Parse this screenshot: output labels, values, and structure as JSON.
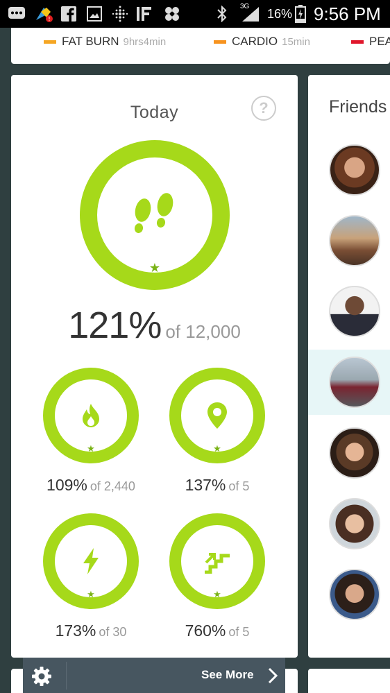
{
  "status_bar": {
    "battery_percent": "16%",
    "network": "3G",
    "time": "9:56 PM",
    "left_icons": [
      "messages-icon",
      "cleaner-app-icon",
      "facebook-icon",
      "gallery-icon",
      "fitbit-icon",
      "ifttt-icon",
      "pinwheel-icon"
    ]
  },
  "zones": [
    {
      "label": "FAT BURN",
      "duration": "9hrs4min",
      "color": "#f5a623"
    },
    {
      "label": "CARDIO",
      "duration": "15min",
      "color": "#f7931e"
    },
    {
      "label": "PEA",
      "duration": "",
      "color": "#e0162b"
    }
  ],
  "today": {
    "title": "Today",
    "help_label": "?",
    "steps": {
      "percent": "121%",
      "goal": "of 12,000",
      "icon": "footprints-icon"
    },
    "stats": [
      {
        "percent": "109%",
        "goal": "of 2,440",
        "icon": "flame-icon"
      },
      {
        "percent": "137%",
        "goal": "of 5",
        "icon": "location-pin-icon"
      },
      {
        "percent": "173%",
        "goal": "of 30",
        "icon": "lightning-icon"
      },
      {
        "percent": "760%",
        "goal": "of 5",
        "icon": "stairs-icon"
      }
    ]
  },
  "friends": {
    "title": "Friends",
    "avatars": [
      "avatar-1",
      "avatar-2",
      "avatar-3",
      "avatar-4",
      "avatar-5",
      "avatar-6",
      "avatar-7"
    ],
    "highlighted_index": 3
  },
  "nav": {
    "see_more": "See More"
  },
  "colors": {
    "ring": "#a6d91a",
    "nav_bg": "#475660",
    "page_bg": "#2f3f40"
  }
}
